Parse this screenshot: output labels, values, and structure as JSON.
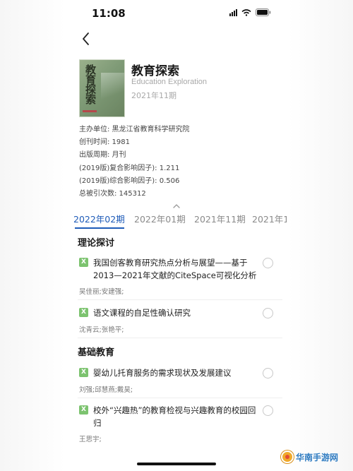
{
  "status_bar": {
    "time": "11:08"
  },
  "journal": {
    "title": "教育探索",
    "title_en": "Education Exploration",
    "issue": "2021年11期",
    "cover_text": "教育探索"
  },
  "meta": [
    "主办单位:  黑龙江省教育科学研究院",
    "创刊时间:  1981",
    "出版周期:  月刊",
    "(2019版)复合影响因子):  1.211",
    "(2019版)综合影响因子):  0.506",
    "总被引次数:  145312"
  ],
  "tabs": [
    "2022年02期",
    "2022年01期",
    "2021年11期",
    "2021年1"
  ],
  "sections": [
    {
      "title": "理论探讨",
      "articles": [
        {
          "tag": "X",
          "title": "我国创客教育研究热点分析与展望——基于2013—2021年文献的CiteSpace可视化分析",
          "authors": "吴佳丽;安建强;"
        },
        {
          "tag": "X",
          "title": "语文课程的自足性确认研究",
          "authors": "沈青云;张艳平;"
        }
      ]
    },
    {
      "title": "基础教育",
      "articles": [
        {
          "tag": "X",
          "title": "婴幼儿托育服务的需求现状及发展建议",
          "authors": "刘强;邱慧燕;戴昊;"
        },
        {
          "tag": "X",
          "title": "校外“兴趣热”的教育检视与兴趣教育的校园回归",
          "authors": "王思宇;"
        }
      ]
    }
  ],
  "watermark": {
    "text": "华南手游网"
  },
  "colors": {
    "accent": "#1e5bb8",
    "tag_green": "#7cc36f"
  }
}
